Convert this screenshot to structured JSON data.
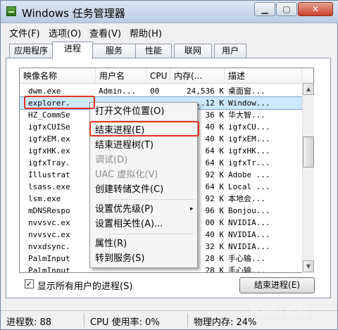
{
  "window": {
    "title": "Windows 任务管理器"
  },
  "menubar": [
    "文件(F)",
    "选项(O)",
    "查看(V)",
    "帮助(H)"
  ],
  "tabs": [
    "应用程序",
    "进程",
    "服务",
    "性能",
    "联网",
    "用户"
  ],
  "list": {
    "columns": [
      "映像名称",
      "用户名",
      "CPU",
      "内存(...",
      "描述"
    ],
    "rows": [
      {
        "name": "dwm.exe",
        "user": "Admin...",
        "cpu": "00",
        "mem": "24,536 K",
        "desc": "桌面窗..."
      },
      {
        "name": "explorer.",
        "user": "",
        "cpu": "",
        "mem": "...12 K",
        "desc": "Window..."
      },
      {
        "name": "HZ_CommSe",
        "user": "",
        "cpu": "",
        "mem": "36 K",
        "desc": "华大智..."
      },
      {
        "name": "igfxCUISe",
        "user": "",
        "cpu": "",
        "mem": "40 K",
        "desc": "igfxCU..."
      },
      {
        "name": "igfxEM.ex",
        "user": "",
        "cpu": "",
        "mem": "40 K",
        "desc": "igfxEM..."
      },
      {
        "name": "igfxHK.ex",
        "user": "",
        "cpu": "",
        "mem": "64 K",
        "desc": "igfxHK..."
      },
      {
        "name": "igfxTray.",
        "user": "",
        "cpu": "",
        "mem": "64 K",
        "desc": "igfxTr..."
      },
      {
        "name": "Illustrat",
        "user": "",
        "cpu": "",
        "mem": "92 K",
        "desc": "Adobe ..."
      },
      {
        "name": "lsass.exe",
        "user": "",
        "cpu": "",
        "mem": "64 K",
        "desc": "Local ..."
      },
      {
        "name": "lsm.exe",
        "user": "",
        "cpu": "",
        "mem": "92 K",
        "desc": "本地会..."
      },
      {
        "name": "mDNSRespo",
        "user": "",
        "cpu": "",
        "mem": "96 K",
        "desc": "Bonjou..."
      },
      {
        "name": "nvvsvc.ex",
        "user": "",
        "cpu": "",
        "mem": "00 K",
        "desc": "NVIDIA..."
      },
      {
        "name": "nvvsvc.ex",
        "user": "",
        "cpu": "",
        "mem": "40 K",
        "desc": "NVIDIA..."
      },
      {
        "name": "nvxdsync.",
        "user": "",
        "cpu": "",
        "mem": "32 K",
        "desc": "NVIDIA..."
      },
      {
        "name": "PalmInput",
        "user": "",
        "cpu": "",
        "mem": "28 K",
        "desc": "手心输..."
      },
      {
        "name": "PalmInput",
        "user": "",
        "cpu": "",
        "mem": "28 K",
        "desc": "手心输..."
      }
    ]
  },
  "context_menu": {
    "open_location": "打开文件位置(O)",
    "end_process": "结束进程(E)",
    "end_tree": "结束进程树(T)",
    "debug": "调试(D)",
    "uac": "UAC 虚拟化(V)",
    "dump": "创建转储文件(C)",
    "priority": "设置优先级(P)",
    "affinity": "设置相关性(A)...",
    "properties": "属性(R)",
    "goto_service": "转到服务(S)"
  },
  "show_all_users": {
    "label": "显示所有用户的进程(S)",
    "checked": true,
    "mark": "✓"
  },
  "end_process_button": "结束进程(E)",
  "status": {
    "processes": "进程数: 88",
    "cpu": "CPU 使用率: 0%",
    "memory": "物理内存: 24%"
  },
  "watermark": "Baidu 经验",
  "colors": {
    "highlight": "#e53222",
    "selected_row": "#cde8ff"
  }
}
